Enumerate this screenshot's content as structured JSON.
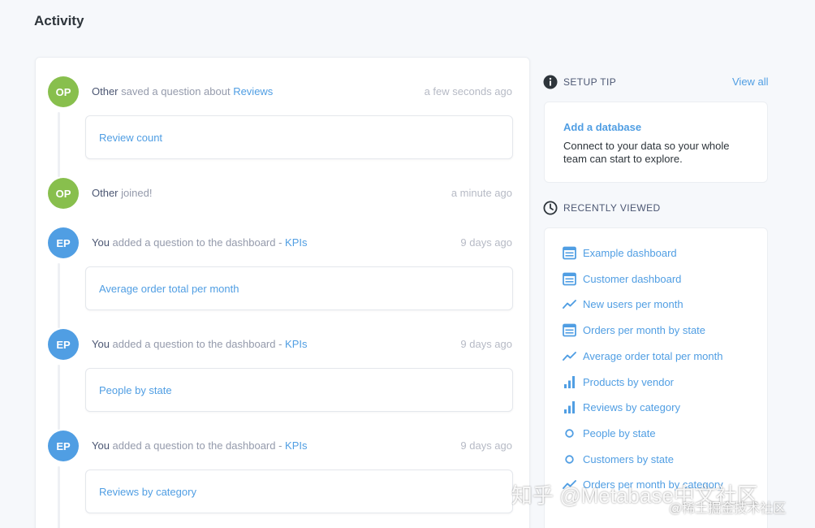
{
  "page": {
    "title": "Activity"
  },
  "feed": [
    {
      "initials": "OP",
      "color": "#88bf4d",
      "actor": "Other",
      "action": " saved a question about ",
      "link": "Reviews",
      "time": "a few seconds ago",
      "card": "Review count"
    },
    {
      "initials": "OP",
      "color": "#88bf4d",
      "actor": "Other",
      "action": " joined!",
      "link": "",
      "time": "a minute ago",
      "card": ""
    },
    {
      "initials": "EP",
      "color": "#509ee3",
      "actor": "You",
      "action": " added a question to the dashboard - ",
      "link": "KPIs",
      "time": "9 days ago",
      "card": "Average order total per month"
    },
    {
      "initials": "EP",
      "color": "#509ee3",
      "actor": "You",
      "action": " added a question to the dashboard - ",
      "link": "KPIs",
      "time": "9 days ago",
      "card": "People by state"
    },
    {
      "initials": "EP",
      "color": "#509ee3",
      "actor": "You",
      "action": " added a question to the dashboard - ",
      "link": "KPIs",
      "time": "9 days ago",
      "card": "Reviews by category"
    }
  ],
  "setup_tip": {
    "heading": "SETUP TIP",
    "view_all": "View all",
    "title": "Add a database",
    "body": "Connect to your data so your whole team can start to explore."
  },
  "recently_viewed": {
    "heading": "RECENTLY VIEWED",
    "items": [
      {
        "label": "Example dashboard",
        "icon": "dashboard-icon"
      },
      {
        "label": "Customer dashboard",
        "icon": "dashboard-icon"
      },
      {
        "label": "New users per month",
        "icon": "line-chart-icon"
      },
      {
        "label": "Orders per month by state",
        "icon": "dashboard-icon"
      },
      {
        "label": "Average order total per month",
        "icon": "line-chart-icon"
      },
      {
        "label": "Products by vendor",
        "icon": "bar-chart-icon"
      },
      {
        "label": "Reviews by category",
        "icon": "bar-chart-icon"
      },
      {
        "label": "People by state",
        "icon": "pin-icon"
      },
      {
        "label": "Customers by state",
        "icon": "pin-icon"
      },
      {
        "label": "Orders per month by category",
        "icon": "line-chart-icon"
      }
    ]
  },
  "watermark": {
    "main": "知乎 @Metabase中文社区",
    "sub": "@稀土掘金技术社区"
  },
  "colors": {
    "accent": "#509ee3",
    "avatar_green": "#88bf4d",
    "avatar_blue": "#509ee3"
  }
}
